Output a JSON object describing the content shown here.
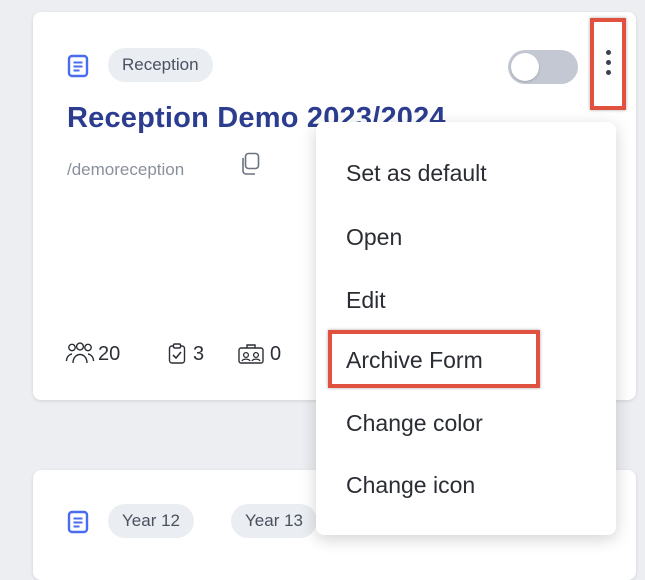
{
  "card1": {
    "tag": "Reception",
    "title": "Reception Demo 2023/2024",
    "slug": "/demoreception",
    "stats": {
      "members": "20",
      "forms": "3",
      "other": "0"
    },
    "toggle_on": false
  },
  "menu": {
    "items": [
      "Set as default",
      "Open",
      "Edit",
      "Archive Form",
      "Change color",
      "Change icon"
    ]
  },
  "card2": {
    "tags": [
      "Year 12",
      "Year 13"
    ]
  },
  "colors": {
    "title": "#2c3d8f",
    "icon_blue": "#4b6cf0",
    "highlight": "#e0523f",
    "toggle_off": "#c3c8d2"
  }
}
